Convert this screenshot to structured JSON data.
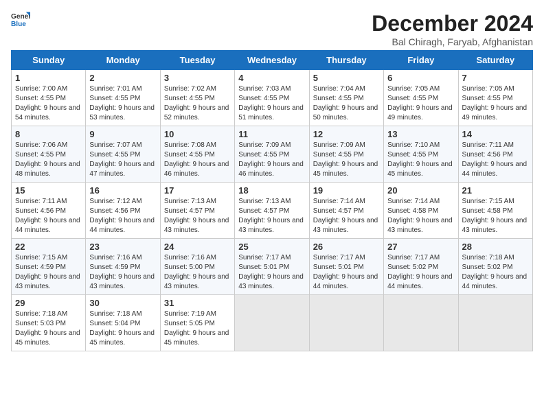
{
  "header": {
    "logo_general": "General",
    "logo_blue": "Blue",
    "title": "December 2024",
    "subtitle": "Bal Chiragh, Faryab, Afghanistan"
  },
  "columns": [
    "Sunday",
    "Monday",
    "Tuesday",
    "Wednesday",
    "Thursday",
    "Friday",
    "Saturday"
  ],
  "weeks": [
    [
      {
        "day": "1",
        "sunrise": "Sunrise: 7:00 AM",
        "sunset": "Sunset: 4:55 PM",
        "daylight": "Daylight: 9 hours and 54 minutes."
      },
      {
        "day": "2",
        "sunrise": "Sunrise: 7:01 AM",
        "sunset": "Sunset: 4:55 PM",
        "daylight": "Daylight: 9 hours and 53 minutes."
      },
      {
        "day": "3",
        "sunrise": "Sunrise: 7:02 AM",
        "sunset": "Sunset: 4:55 PM",
        "daylight": "Daylight: 9 hours and 52 minutes."
      },
      {
        "day": "4",
        "sunrise": "Sunrise: 7:03 AM",
        "sunset": "Sunset: 4:55 PM",
        "daylight": "Daylight: 9 hours and 51 minutes."
      },
      {
        "day": "5",
        "sunrise": "Sunrise: 7:04 AM",
        "sunset": "Sunset: 4:55 PM",
        "daylight": "Daylight: 9 hours and 50 minutes."
      },
      {
        "day": "6",
        "sunrise": "Sunrise: 7:05 AM",
        "sunset": "Sunset: 4:55 PM",
        "daylight": "Daylight: 9 hours and 49 minutes."
      },
      {
        "day": "7",
        "sunrise": "Sunrise: 7:05 AM",
        "sunset": "Sunset: 4:55 PM",
        "daylight": "Daylight: 9 hours and 49 minutes."
      }
    ],
    [
      {
        "day": "8",
        "sunrise": "Sunrise: 7:06 AM",
        "sunset": "Sunset: 4:55 PM",
        "daylight": "Daylight: 9 hours and 48 minutes."
      },
      {
        "day": "9",
        "sunrise": "Sunrise: 7:07 AM",
        "sunset": "Sunset: 4:55 PM",
        "daylight": "Daylight: 9 hours and 47 minutes."
      },
      {
        "day": "10",
        "sunrise": "Sunrise: 7:08 AM",
        "sunset": "Sunset: 4:55 PM",
        "daylight": "Daylight: 9 hours and 46 minutes."
      },
      {
        "day": "11",
        "sunrise": "Sunrise: 7:09 AM",
        "sunset": "Sunset: 4:55 PM",
        "daylight": "Daylight: 9 hours and 46 minutes."
      },
      {
        "day": "12",
        "sunrise": "Sunrise: 7:09 AM",
        "sunset": "Sunset: 4:55 PM",
        "daylight": "Daylight: 9 hours and 45 minutes."
      },
      {
        "day": "13",
        "sunrise": "Sunrise: 7:10 AM",
        "sunset": "Sunset: 4:55 PM",
        "daylight": "Daylight: 9 hours and 45 minutes."
      },
      {
        "day": "14",
        "sunrise": "Sunrise: 7:11 AM",
        "sunset": "Sunset: 4:56 PM",
        "daylight": "Daylight: 9 hours and 44 minutes."
      }
    ],
    [
      {
        "day": "15",
        "sunrise": "Sunrise: 7:11 AM",
        "sunset": "Sunset: 4:56 PM",
        "daylight": "Daylight: 9 hours and 44 minutes."
      },
      {
        "day": "16",
        "sunrise": "Sunrise: 7:12 AM",
        "sunset": "Sunset: 4:56 PM",
        "daylight": "Daylight: 9 hours and 44 minutes."
      },
      {
        "day": "17",
        "sunrise": "Sunrise: 7:13 AM",
        "sunset": "Sunset: 4:57 PM",
        "daylight": "Daylight: 9 hours and 43 minutes."
      },
      {
        "day": "18",
        "sunrise": "Sunrise: 7:13 AM",
        "sunset": "Sunset: 4:57 PM",
        "daylight": "Daylight: 9 hours and 43 minutes."
      },
      {
        "day": "19",
        "sunrise": "Sunrise: 7:14 AM",
        "sunset": "Sunset: 4:57 PM",
        "daylight": "Daylight: 9 hours and 43 minutes."
      },
      {
        "day": "20",
        "sunrise": "Sunrise: 7:14 AM",
        "sunset": "Sunset: 4:58 PM",
        "daylight": "Daylight: 9 hours and 43 minutes."
      },
      {
        "day": "21",
        "sunrise": "Sunrise: 7:15 AM",
        "sunset": "Sunset: 4:58 PM",
        "daylight": "Daylight: 9 hours and 43 minutes."
      }
    ],
    [
      {
        "day": "22",
        "sunrise": "Sunrise: 7:15 AM",
        "sunset": "Sunset: 4:59 PM",
        "daylight": "Daylight: 9 hours and 43 minutes."
      },
      {
        "day": "23",
        "sunrise": "Sunrise: 7:16 AM",
        "sunset": "Sunset: 4:59 PM",
        "daylight": "Daylight: 9 hours and 43 minutes."
      },
      {
        "day": "24",
        "sunrise": "Sunrise: 7:16 AM",
        "sunset": "Sunset: 5:00 PM",
        "daylight": "Daylight: 9 hours and 43 minutes."
      },
      {
        "day": "25",
        "sunrise": "Sunrise: 7:17 AM",
        "sunset": "Sunset: 5:01 PM",
        "daylight": "Daylight: 9 hours and 43 minutes."
      },
      {
        "day": "26",
        "sunrise": "Sunrise: 7:17 AM",
        "sunset": "Sunset: 5:01 PM",
        "daylight": "Daylight: 9 hours and 44 minutes."
      },
      {
        "day": "27",
        "sunrise": "Sunrise: 7:17 AM",
        "sunset": "Sunset: 5:02 PM",
        "daylight": "Daylight: 9 hours and 44 minutes."
      },
      {
        "day": "28",
        "sunrise": "Sunrise: 7:18 AM",
        "sunset": "Sunset: 5:02 PM",
        "daylight": "Daylight: 9 hours and 44 minutes."
      }
    ],
    [
      {
        "day": "29",
        "sunrise": "Sunrise: 7:18 AM",
        "sunset": "Sunset: 5:03 PM",
        "daylight": "Daylight: 9 hours and 45 minutes."
      },
      {
        "day": "30",
        "sunrise": "Sunrise: 7:18 AM",
        "sunset": "Sunset: 5:04 PM",
        "daylight": "Daylight: 9 hours and 45 minutes."
      },
      {
        "day": "31",
        "sunrise": "Sunrise: 7:19 AM",
        "sunset": "Sunset: 5:05 PM",
        "daylight": "Daylight: 9 hours and 45 minutes."
      },
      null,
      null,
      null,
      null
    ]
  ]
}
